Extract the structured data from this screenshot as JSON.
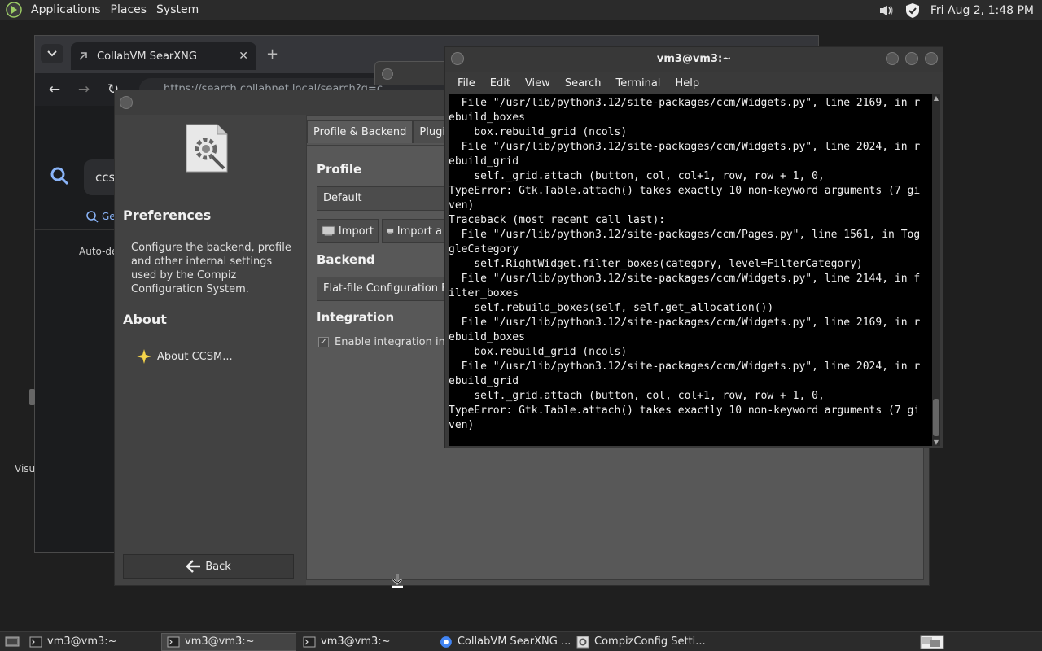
{
  "top_panel": {
    "menus": [
      "Applications",
      "Places",
      "System"
    ],
    "clock": "Fri Aug  2,  1:48 PM"
  },
  "browser": {
    "tab_title": "CollabVM SearXNG",
    "url": "https://search.collabnet.local/search?q=c",
    "search_value": "ccs",
    "result_tab": "Ge",
    "auto_text": "Auto-de",
    "visu_text": "Visu"
  },
  "ccsm": {
    "left": {
      "title": "Preferences",
      "description": "Configure the backend, profile and other internal settings used by the Compiz Configuration System.",
      "about_title": "About",
      "about_link": "About CCSM...",
      "back": "Back"
    },
    "tabs": [
      "Profile & Backend",
      "Plugin L"
    ],
    "profile_heading": "Profile",
    "profile_value": "Default",
    "import_label": "Import",
    "import_as_label": "Import a",
    "backend_heading": "Backend",
    "backend_value": "Flat-file Configuration Ba",
    "integration_heading": "Integration",
    "integration_check": "Enable integration into"
  },
  "terminal": {
    "title": "vm3@vm3:~",
    "menu": [
      "File",
      "Edit",
      "View",
      "Search",
      "Terminal",
      "Help"
    ],
    "lines": [
      "  File \"/usr/lib/python3.12/site-packages/ccm/Widgets.py\", line 2169, in r",
      "ebuild_boxes",
      "    box.rebuild_grid (ncols)",
      "  File \"/usr/lib/python3.12/site-packages/ccm/Widgets.py\", line 2024, in r",
      "ebuild_grid",
      "    self._grid.attach (button, col, col+1, row, row + 1, 0,",
      "TypeError: Gtk.Table.attach() takes exactly 10 non-keyword arguments (7 gi",
      "ven)",
      "Traceback (most recent call last):",
      "  File \"/usr/lib/python3.12/site-packages/ccm/Pages.py\", line 1561, in Tog",
      "gleCategory",
      "    self.RightWidget.filter_boxes(category, level=FilterCategory)",
      "  File \"/usr/lib/python3.12/site-packages/ccm/Widgets.py\", line 2144, in f",
      "ilter_boxes",
      "    self.rebuild_boxes(self, self.get_allocation())",
      "  File \"/usr/lib/python3.12/site-packages/ccm/Widgets.py\", line 2169, in r",
      "ebuild_boxes",
      "    box.rebuild_grid (ncols)",
      "  File \"/usr/lib/python3.12/site-packages/ccm/Widgets.py\", line 2024, in r",
      "ebuild_grid",
      "    self._grid.attach (button, col, col+1, row, row + 1, 0,",
      "TypeError: Gtk.Table.attach() takes exactly 10 non-keyword arguments (7 gi",
      "ven)"
    ]
  },
  "taskbar": {
    "tasks": [
      "vm3@vm3:~",
      "vm3@vm3:~",
      "vm3@vm3:~",
      "CollabVM SearXNG ...",
      "CompizConfig Setti..."
    ],
    "active_index": 1
  },
  "icons": {
    "menu_logo": "gnome-foot-icon",
    "volume": "volume-icon",
    "shield": "shield-icon",
    "about": "sparkle-icon"
  }
}
